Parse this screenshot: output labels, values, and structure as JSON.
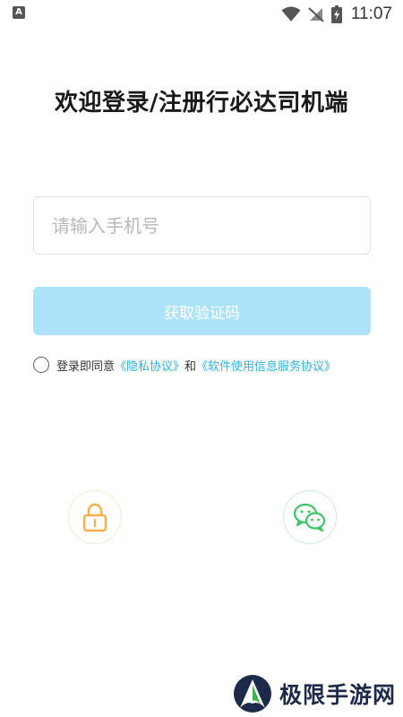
{
  "status_bar": {
    "time": "11:07",
    "left_icon": "a-notification-icon",
    "icons": [
      "wifi-icon",
      "no-signal-icon",
      "battery-charging-icon"
    ]
  },
  "title": "欢迎登录/注册行必达司机端",
  "phone_input": {
    "placeholder": "请输入手机号",
    "value": ""
  },
  "code_button": {
    "label": "获取验证码",
    "color": "#ade3fa"
  },
  "agreement": {
    "checked": false,
    "prefix": "登录即同意",
    "privacy_link": "《隐私协议》",
    "and": "和",
    "service_link": "《软件使用信息服务协议》",
    "link_color": "#2bb3e8"
  },
  "alt_login": [
    {
      "icon": "lock-icon",
      "color": "#f4b04a"
    },
    {
      "icon": "wechat-icon",
      "color": "#3cc466"
    }
  ],
  "watermark": {
    "text": "极限手游网"
  }
}
